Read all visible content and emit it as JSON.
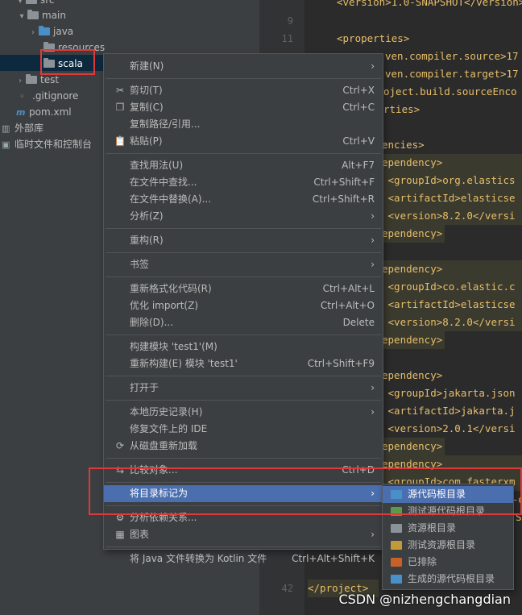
{
  "tree": {
    "items": [
      {
        "label": "src",
        "chevron": "▾"
      },
      {
        "label": "main",
        "chevron": "▾"
      },
      {
        "label": "java",
        "chevron": "›"
      },
      {
        "label": "resources",
        "chevron": ""
      },
      {
        "label": "scala",
        "chevron": ""
      },
      {
        "label": "test",
        "chevron": "›"
      },
      {
        "label": ".gitignore"
      },
      {
        "label": "pom.xml"
      },
      {
        "label": "外部库"
      },
      {
        "label": "临时文件和控制台"
      }
    ]
  },
  "editor": {
    "line_numbers": [
      {
        "n": "9"
      },
      {
        "n": "11"
      },
      {
        "n": "42"
      }
    ],
    "lines": [
      {
        "text": "<version>1.0-SNAPSHOT</version>"
      },
      {
        "text": "<properties>"
      },
      {
        "text": "ven.compiler.source>17"
      },
      {
        "text": "ven.compiler.target>17"
      },
      {
        "text": "oject.build.sourceEnco"
      },
      {
        "text": "rties>"
      },
      {
        "text": "encies>"
      },
      {
        "text": "ependency>"
      },
      {
        "text": " <groupId>org.elastics"
      },
      {
        "text": " <artifactId>elasticse"
      },
      {
        "text": " <version>8.2.0</versi"
      },
      {
        "text": "ependency>"
      },
      {
        "text": "ependency>"
      },
      {
        "text": " <groupId>co.elastic.c"
      },
      {
        "text": " <artifactId>elasticse"
      },
      {
        "text": " <version>8.2.0</versi"
      },
      {
        "text": "ependency>"
      },
      {
        "text": "ependency>"
      },
      {
        "text": " <groupId>jakarta.json"
      },
      {
        "text": " <artifactId>jakarta.j"
      },
      {
        "text": " <version>2.0.1</versi"
      },
      {
        "text": "ependency>"
      },
      {
        "text": "ependency>"
      },
      {
        "text": " <groupId>com.fasterxm"
      },
      {
        "text": "-d"
      },
      {
        "text": "S"
      },
      {
        "text": "</project>"
      }
    ]
  },
  "menu": {
    "items": [
      {
        "label": "新建(N)",
        "shortcut": "",
        "icon": ""
      },
      {
        "label": "剪切(T)",
        "shortcut": "Ctrl+X",
        "icon": "✂"
      },
      {
        "label": "复制(C)",
        "shortcut": "Ctrl+C",
        "icon": "❐"
      },
      {
        "label": "复制路径/引用...",
        "shortcut": "",
        "icon": ""
      },
      {
        "label": "粘贴(P)",
        "shortcut": "Ctrl+V",
        "icon": "📋"
      },
      {
        "label": "查找用法(U)",
        "shortcut": "Alt+F7",
        "icon": ""
      },
      {
        "label": "在文件中查找...",
        "shortcut": "Ctrl+Shift+F",
        "icon": ""
      },
      {
        "label": "在文件中替换(A)...",
        "shortcut": "Ctrl+Shift+R",
        "icon": ""
      },
      {
        "label": "分析(Z)",
        "shortcut": "",
        "icon": ""
      },
      {
        "label": "重构(R)",
        "shortcut": "",
        "icon": ""
      },
      {
        "label": "书签",
        "shortcut": "",
        "icon": ""
      },
      {
        "label": "重新格式化代码(R)",
        "shortcut": "Ctrl+Alt+L",
        "icon": ""
      },
      {
        "label": "优化 import(Z)",
        "shortcut": "Ctrl+Alt+O",
        "icon": ""
      },
      {
        "label": "删除(D)...",
        "shortcut": "Delete",
        "icon": ""
      },
      {
        "label": "构建模块 'test1'(M)",
        "shortcut": "",
        "icon": ""
      },
      {
        "label": "重新构建(E) 模块 'test1'",
        "shortcut": "Ctrl+Shift+F9",
        "icon": ""
      },
      {
        "label": "打开于",
        "shortcut": "",
        "icon": ""
      },
      {
        "label": "本地历史记录(H)",
        "shortcut": "",
        "icon": ""
      },
      {
        "label": "修复文件上的 IDE",
        "shortcut": "",
        "icon": ""
      },
      {
        "label": "从磁盘重新加载",
        "shortcut": "",
        "icon": "⟳"
      },
      {
        "label": "比较对象...",
        "shortcut": "Ctrl+D",
        "icon": "⇆"
      },
      {
        "label": "将目录标记为",
        "shortcut": "",
        "icon": ""
      },
      {
        "label": "分析依赖关系...",
        "shortcut": "",
        "icon": "⚙"
      },
      {
        "label": "图表",
        "shortcut": "",
        "icon": "▦"
      },
      {
        "label": "将 Java 文件转换为 Kotlin 文件",
        "shortcut": "Ctrl+Alt+Shift+K",
        "icon": ""
      }
    ]
  },
  "submenu": {
    "items": [
      {
        "label": "源代码根目录",
        "color": "#4a90c8"
      },
      {
        "label": "测试源代码根目录",
        "color": "#5a9a4a"
      },
      {
        "label": "资源根目录",
        "color": "#8b9399"
      },
      {
        "label": "测试资源根目录",
        "color": "#c29a3a"
      },
      {
        "label": "已排除",
        "color": "#c8602a"
      },
      {
        "label": "生成的源代码根目录",
        "color": "#4a90c8"
      }
    ]
  },
  "watermark": "CSDN @nizhengchangdian"
}
